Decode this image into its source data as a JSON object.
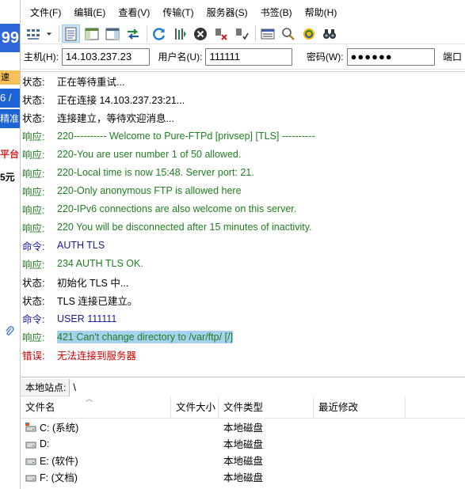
{
  "menu": [
    "文件(F)",
    "编辑(E)",
    "查看(V)",
    "传输(T)",
    "服务器(S)",
    "书签(B)",
    "帮助(H)"
  ],
  "quick": {
    "host_label": "主机(H):",
    "host_value": "14.103.237.23",
    "user_label": "用户名(U):",
    "user_value": "111111",
    "pass_label": "密码(W):",
    "pass_value": "●●●●●●",
    "port_label": "端口"
  },
  "log": [
    {
      "type": "状态:",
      "msg": "正在等待重试...",
      "kind": "status"
    },
    {
      "type": "状态:",
      "msg": "正在连接 14.103.237.23:21...",
      "kind": "status"
    },
    {
      "type": "状态:",
      "msg": "连接建立，等待欢迎消息...",
      "kind": "status"
    },
    {
      "type": "响应:",
      "msg": "220---------- Welcome to Pure-FTPd [privsep] [TLS] ----------",
      "kind": "resp"
    },
    {
      "type": "响应:",
      "msg": "220-You are user number 1 of 50 allowed.",
      "kind": "resp"
    },
    {
      "type": "响应:",
      "msg": "220-Local time is now 15:48. Server port: 21.",
      "kind": "resp"
    },
    {
      "type": "响应:",
      "msg": "220-Only anonymous FTP is allowed here",
      "kind": "resp"
    },
    {
      "type": "响应:",
      "msg": "220-IPv6 connections are also welcome on this server.",
      "kind": "resp"
    },
    {
      "type": "响应:",
      "msg": "220 You will be disconnected after 15 minutes of inactivity.",
      "kind": "resp"
    },
    {
      "type": "命令:",
      "msg": "AUTH TLS",
      "kind": "cmd"
    },
    {
      "type": "响应:",
      "msg": "234 AUTH TLS OK.",
      "kind": "resp"
    },
    {
      "type": "状态:",
      "msg": "初始化 TLS 中...",
      "kind": "status"
    },
    {
      "type": "状态:",
      "msg": "TLS 连接已建立。",
      "kind": "status"
    },
    {
      "type": "命令:",
      "msg": "USER 111111",
      "kind": "cmd"
    },
    {
      "type": "响应:",
      "msg": "421 Can't change directory to /var/ftp/ [/]",
      "kind": "resp",
      "selected": true
    },
    {
      "type": "错误:",
      "msg": "无法连接到服务器",
      "kind": "err"
    }
  ],
  "local": {
    "label": "本地站点:",
    "path": "\\",
    "columns": [
      "文件名",
      "文件大小",
      "文件类型",
      "最近修改"
    ],
    "files": [
      {
        "name": "C: (系统)",
        "type": "本地磁盘",
        "icon": "system-drive-icon"
      },
      {
        "name": "D:",
        "type": "本地磁盘",
        "icon": "drive-icon"
      },
      {
        "name": "E: (软件)",
        "type": "本地磁盘",
        "icon": "drive-icon"
      },
      {
        "name": "F: (文档)",
        "type": "本地磁盘",
        "icon": "drive-icon"
      }
    ]
  },
  "background_window": {
    "b1": "99",
    "b2": "速",
    "b3": "6 / ",
    "b4": "精准",
    "b5": "平台",
    "b6": "5元"
  }
}
